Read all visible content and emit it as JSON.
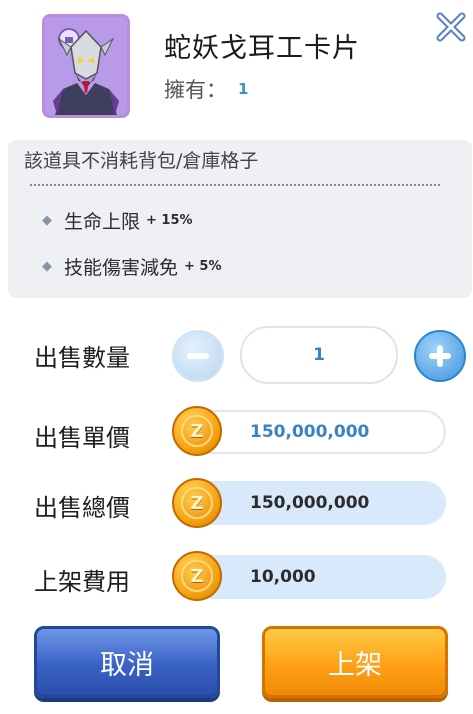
{
  "item": {
    "title": "蛇妖戈耳工卡片",
    "own_label": "擁有：",
    "own_count": "1",
    "icon": "gorgon-card-portrait-icon"
  },
  "info": {
    "note": "該道具不消耗背包/倉庫格子",
    "stats": [
      {
        "name": "生命上限",
        "value": "+ 15%"
      },
      {
        "name": "技能傷害減免",
        "value": "+ 5%"
      }
    ]
  },
  "sell": {
    "quantity_label": "出售數量",
    "quantity_value": "1",
    "unit_price_label": "出售單價",
    "unit_price_value": "150,000,000",
    "total_price_label": "出售總價",
    "total_price_value": "150,000,000",
    "fee_label": "上架費用",
    "fee_value": "10,000",
    "coin_glyph": "Z"
  },
  "buttons": {
    "cancel": "取消",
    "list": "上架"
  },
  "colors": {
    "accent_blue": "#3b82c4",
    "cancel_blue": "#3a62c7",
    "list_orange": "#ffa018",
    "coin_gold": "#f6a413"
  }
}
